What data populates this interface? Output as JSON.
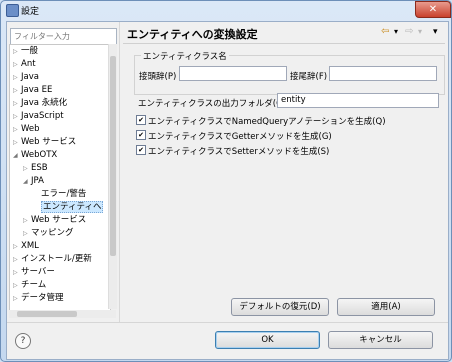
{
  "window": {
    "title": "設定",
    "close_label": "✕"
  },
  "filter": {
    "placeholder": "フィルター入力"
  },
  "tree": {
    "items": [
      {
        "label": "一般",
        "twisty": "▷",
        "indent": 0
      },
      {
        "label": "Ant",
        "twisty": "▷",
        "indent": 0
      },
      {
        "label": "Java",
        "twisty": "▷",
        "indent": 0
      },
      {
        "label": "Java EE",
        "twisty": "▷",
        "indent": 0
      },
      {
        "label": "Java 永続化",
        "twisty": "▷",
        "indent": 0
      },
      {
        "label": "JavaScript",
        "twisty": "▷",
        "indent": 0
      },
      {
        "label": "Web",
        "twisty": "▷",
        "indent": 0
      },
      {
        "label": "Web サービス",
        "twisty": "▷",
        "indent": 0
      },
      {
        "label": "WebOTX",
        "twisty": "◢",
        "indent": 0
      },
      {
        "label": "ESB",
        "twisty": "▷",
        "indent": 1
      },
      {
        "label": "JPA",
        "twisty": "◢",
        "indent": 1
      },
      {
        "label": "エラー/警告",
        "twisty": "",
        "indent": 2
      },
      {
        "label": "エンティティへ",
        "twisty": "",
        "indent": 2,
        "selected": true
      },
      {
        "label": "Web サービス",
        "twisty": "▷",
        "indent": 1
      },
      {
        "label": "マッピング",
        "twisty": "▷",
        "indent": 1
      },
      {
        "label": "XML",
        "twisty": "▷",
        "indent": 0
      },
      {
        "label": "インストール/更新",
        "twisty": "▷",
        "indent": 0
      },
      {
        "label": "サーバー",
        "twisty": "▷",
        "indent": 0
      },
      {
        "label": "チーム",
        "twisty": "▷",
        "indent": 0
      },
      {
        "label": "データ管理",
        "twisty": "▷",
        "indent": 0
      }
    ]
  },
  "page": {
    "title": "エンティティへの変換設定",
    "nav_back": "⇦",
    "nav_back_menu": "▾",
    "nav_forward": "⇨",
    "nav_forward_menu": "▾",
    "view_menu": "▾",
    "group_title": "エンティティクラス名",
    "prefix_label": "接頭辞(P)",
    "prefix_value": "",
    "suffix_label": "接尾辞(F)",
    "suffix_value": "",
    "output_folder_label": "エンティティクラスの出力フォルダ(O)",
    "output_folder_value": "entity",
    "checkboxes": [
      {
        "label": "エンティティクラスでNamedQueryアノテーションを生成(Q)",
        "checked": true
      },
      {
        "label": "エンティティクラスでGetterメソッドを生成(G)",
        "checked": true
      },
      {
        "label": "エンティティクラスでSetterメソッドを生成(S)",
        "checked": true
      }
    ],
    "restore_defaults": "デフォルトの復元(D)",
    "apply": "適用(A)"
  },
  "footer": {
    "help": "?",
    "ok": "OK",
    "cancel": "キャンセル"
  }
}
